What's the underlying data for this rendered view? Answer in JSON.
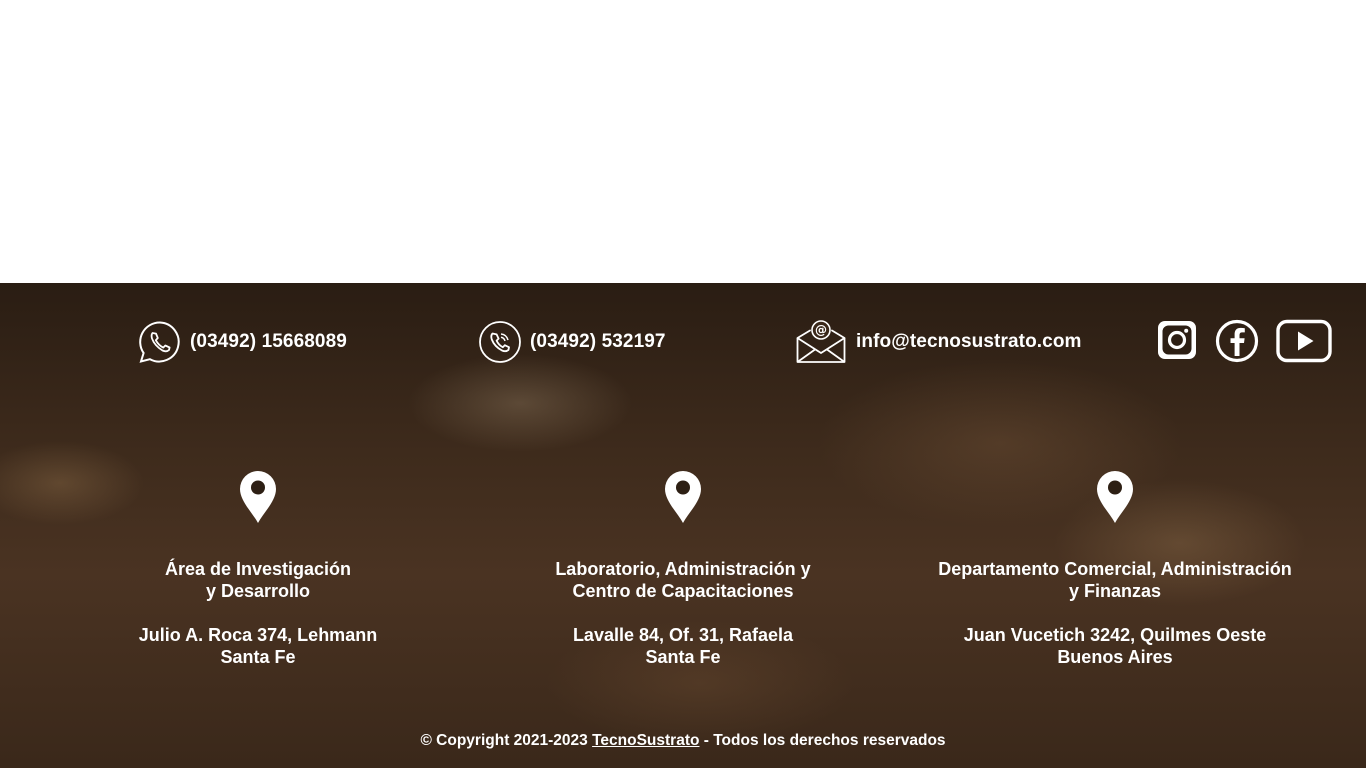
{
  "contacts": {
    "whatsapp": {
      "icon": "whatsapp-icon",
      "text": "(03492) 15668089"
    },
    "phone": {
      "icon": "phone-icon",
      "text": "(03492)  532197"
    },
    "email": {
      "icon": "email-icon",
      "text": "info@tecnosustrato.com"
    }
  },
  "social": [
    {
      "icon": "instagram-icon"
    },
    {
      "icon": "facebook-icon"
    },
    {
      "icon": "youtube-icon"
    }
  ],
  "locations": [
    {
      "name_line1": "Área de Investigación",
      "name_line2": "y Desarrollo",
      "address_line1": "Julio A. Roca 374, Lehmann",
      "address_line2": "Santa Fe",
      "icon": "map-pin-icon"
    },
    {
      "name_line1": "Laboratorio, Administración y",
      "name_line2": "Centro de Capacitaciones",
      "address_line1": "Lavalle 84, Of. 31, Rafaela",
      "address_line2": "Santa Fe",
      "icon": "map-pin-icon"
    },
    {
      "name_line1": "Departamento Comercial, Administración",
      "name_line2": "y Finanzas",
      "address_line1": "Juan Vucetich 3242, Quilmes Oeste",
      "address_line2": "Buenos Aires",
      "icon": "map-pin-icon"
    }
  ],
  "copyright": {
    "prefix": "© Copyright 2021-2023 ",
    "link": "TecnoSustrato",
    "suffix": " - Todos los derechos reservados"
  },
  "colors": {
    "text": "#ffffff",
    "background_top": "#ffffff",
    "soil_dark": "#2a1d13",
    "soil_mid": "#4a3322"
  }
}
